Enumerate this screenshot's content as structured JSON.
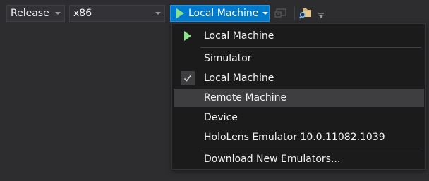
{
  "toolbar": {
    "configuration": {
      "value": "Release"
    },
    "platform": {
      "value": "x86"
    },
    "run_target": {
      "label": "Local Machine"
    }
  },
  "colors": {
    "accent": "#007acc",
    "play": "#8ae28a",
    "menu_bg": "#1b1b1c",
    "highlight": "#3e3e40"
  },
  "dropdown": {
    "items": [
      {
        "label": "Local Machine",
        "icon": "play-icon"
      },
      {
        "label": "Simulator"
      },
      {
        "label": "Local Machine",
        "checked": true,
        "icon": "check-icon"
      },
      {
        "label": "Remote Machine",
        "highlighted": true
      },
      {
        "label": "Device"
      },
      {
        "label": "HoloLens Emulator 10.0.11082.1039"
      },
      {
        "label": "Download New Emulators..."
      }
    ]
  }
}
